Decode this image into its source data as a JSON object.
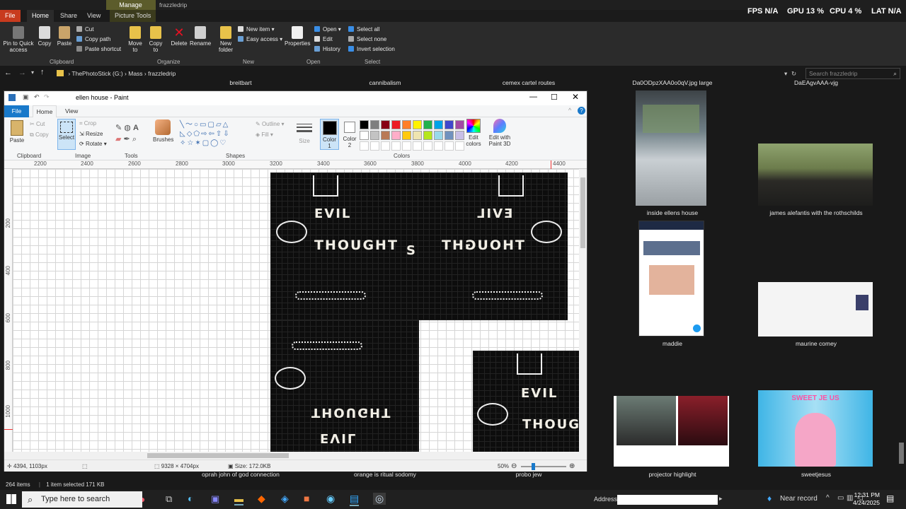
{
  "explorer": {
    "window_title": "frazzledrip",
    "contextual_tab": "Manage",
    "tabs": [
      "File",
      "Home",
      "Share",
      "View",
      "Picture Tools"
    ],
    "clipboard": {
      "pin": "Pin to Quick access",
      "copy": "Copy",
      "paste": "Paste",
      "cut": "Cut",
      "copy_path": "Copy path",
      "paste_shortcut": "Paste shortcut",
      "label": "Clipboard"
    },
    "organize": {
      "move": "Move to",
      "copy": "Copy to",
      "delete": "Delete",
      "rename": "Rename",
      "label": "Organize"
    },
    "new": {
      "folder": "New folder",
      "new_item": "New item",
      "easy_access": "Easy access",
      "label": "New"
    },
    "open": {
      "properties": "Properties",
      "open": "Open",
      "edit": "Edit",
      "history": "History",
      "label": "Open"
    },
    "select": {
      "all": "Select all",
      "none": "Select none",
      "invert": "Invert selection",
      "label": "Select"
    },
    "breadcrumb": [
      "ThePhotoStick (G:)",
      "Mass",
      "frazzledrip"
    ],
    "search_placeholder": "Search frazzledrip",
    "status_items": "264 items",
    "status_selected": "1 item selected  171 KB"
  },
  "hud": {
    "fps_label": "FPS",
    "fps": "N/A",
    "gpu_label": "GPU",
    "gpu": "13 %",
    "cpu_label": "CPU",
    "cpu": "4 %",
    "lat_label": "LAT",
    "lat": "N/A"
  },
  "paint": {
    "title": "ellen house - Paint",
    "tabs": [
      "File",
      "Home",
      "View"
    ],
    "clipboard": {
      "paste": "Paste",
      "cut": "Cut",
      "copy": "Copy",
      "label": "Clipboard"
    },
    "image": {
      "select": "Select",
      "crop": "Crop",
      "resize": "Resize",
      "rotate": "Rotate",
      "label": "Image"
    },
    "tools_label": "Tools",
    "brushes": "Brushes",
    "shapes": {
      "outline": "Outline",
      "fill": "Fill",
      "label": "Shapes"
    },
    "size": "Size",
    "color1": "Color 1",
    "color2": "Color 2",
    "colors_label": "Colors",
    "edit_colors": "Edit colors",
    "edit_3d": "Edit with Paint 3D",
    "ruler_h": [
      "2200",
      "2400",
      "2600",
      "2800",
      "3000",
      "3200",
      "3400",
      "3600",
      "3800",
      "4000",
      "4200",
      "4400"
    ],
    "ruler_v": [
      "200",
      "400",
      "600",
      "800",
      "1000"
    ],
    "palette_row1": [
      "#000000",
      "#7f7f7f",
      "#880015",
      "#ed1c24",
      "#ff7f27",
      "#fff200",
      "#22b14c",
      "#00a2e8",
      "#3f48cc",
      "#a349a4"
    ],
    "palette_row2": [
      "#ffffff",
      "#c3c3c3",
      "#b97a57",
      "#ffaec9",
      "#ffc90e",
      "#efe4b0",
      "#b5e61d",
      "#99d9ea",
      "#7092be",
      "#c8bfe7"
    ],
    "image_text": {
      "evil": "EVIL",
      "thought": "THOUGHT",
      "s": "S"
    },
    "status": {
      "cursor": "4394, 1103px",
      "dims": "9328 × 4704px",
      "size": "Size: 172.0KB",
      "zoom": "50%"
    }
  },
  "files": {
    "top_labels": [
      "breitbart",
      "cannibalism",
      "cemex cartel routes",
      "Da0ODpzXAA0o0qV.jpg large",
      "DaEAgvAAA-vjg"
    ],
    "items": [
      {
        "label": "inside ellens house"
      },
      {
        "label": "james alefantis with the rothschilds"
      },
      {
        "label": "maddie"
      },
      {
        "label": "maurine comey"
      },
      {
        "label": "projector highlight"
      },
      {
        "label": "sweetjesus"
      }
    ],
    "bottom_labels": [
      "oprah john  of god connection",
      "orange is ritual sodomy",
      "probo jew"
    ],
    "sweet_text": "SWEET JE US"
  },
  "taskbar": {
    "search_placeholder": "Type here to search",
    "address_label": "Address",
    "near_record": "Near record",
    "time": "12:31 PM",
    "date": "4/24/2025"
  }
}
